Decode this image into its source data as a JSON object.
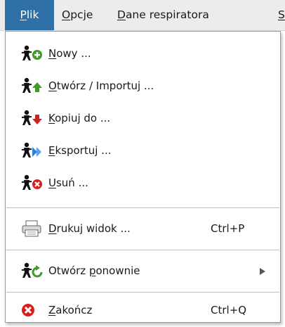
{
  "menubar": {
    "items": [
      {
        "prefix": "",
        "mnemonic": "P",
        "rest": "lik"
      },
      {
        "prefix": "",
        "mnemonic": "O",
        "rest": "pcje"
      },
      {
        "prefix": "",
        "mnemonic": "D",
        "rest": "ane respiratora"
      },
      {
        "prefix": "",
        "mnemonic": "S",
        "rest": ""
      }
    ]
  },
  "menu": {
    "items": [
      {
        "icon": "person-add-icon",
        "prefix": "",
        "mnemonic": "N",
        "rest": "owy ...",
        "shortcut": ""
      },
      {
        "icon": "person-import-icon",
        "prefix": "",
        "mnemonic": "O",
        "rest": "twórz / Importuj ...",
        "shortcut": ""
      },
      {
        "icon": "person-copy-icon",
        "prefix": "",
        "mnemonic": "K",
        "rest": "opiuj do ...",
        "shortcut": ""
      },
      {
        "icon": "person-export-icon",
        "prefix": "",
        "mnemonic": "E",
        "rest": "ksportuj ...",
        "shortcut": ""
      },
      {
        "icon": "person-delete-icon",
        "prefix": "",
        "mnemonic": "U",
        "rest": "suń ...",
        "shortcut": ""
      },
      {
        "icon": "printer-icon",
        "prefix": "",
        "mnemonic": "D",
        "rest": "rukuj widok ...",
        "shortcut": "Ctrl+P"
      },
      {
        "icon": "person-reopen-icon",
        "prefix": "Otwórz ",
        "mnemonic": "p",
        "rest": "onownie",
        "shortcut": ""
      },
      {
        "icon": "close-icon",
        "prefix": "",
        "mnemonic": "Z",
        "rest": "akończ",
        "shortcut": "Ctrl+Q"
      }
    ]
  },
  "colors": {
    "menubar_active": "#2f6fa8",
    "add_green": "#3f9a2a",
    "delete_red": "#d62020",
    "export_blue": "#2b7fd8"
  }
}
